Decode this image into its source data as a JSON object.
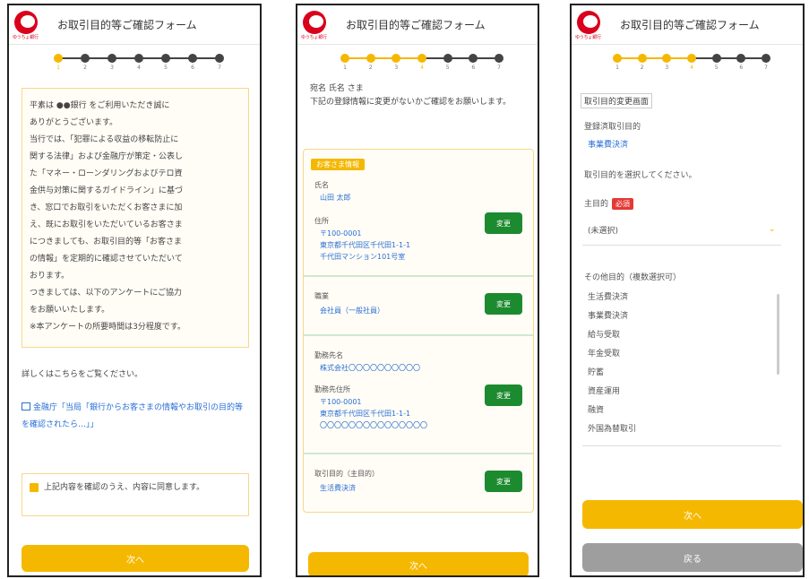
{
  "app": {
    "title": "お取引目的等ご確認フォーム",
    "logo_text": "ゆうちょ銀行"
  },
  "steps": {
    "labels": [
      "1",
      "2",
      "3",
      "4",
      "5",
      "6",
      "7"
    ]
  },
  "screen1": {
    "current_step": 1,
    "notice_lines": [
      "平素は ●●銀行 をご利用いただき誠に",
      "ありがとうございます。",
      "当行では、「犯罪による収益の移転防止に",
      "関する法律」および金融庁が策定・公表し",
      "た「マネー・ローンダリングおよびテロ資",
      "金供与対策に関するガイドライン」に基づ",
      "き、窓口でお取引をいただくお客さまに加",
      "え、既にお取引をいただいているお客さま",
      "につきましても、お取引目的等「お客さま",
      "の情報」を定期的に確認させていただいて",
      "おります。",
      "つきましては、以下のアンケートにご協力",
      "をお願いいたします。",
      "※本アンケートの所要時間は3分程度です。"
    ],
    "note": "詳しくはこちらをご覧ください。",
    "link": "金融庁「当局「銀行からお客さまの情報やお取引の目的等を確認されたら…」」",
    "consent": "上記内容を確認のうえ、内容に同意します。",
    "next_button": "次へ"
  },
  "screen2": {
    "current_step": 4,
    "intro": "宛名 氏名 さま\n下記の登録情報に変更がないかご確認をお願いします。",
    "tag": "お客さま情報",
    "block1": {
      "name_label": "氏名",
      "name_value": "山田 太郎",
      "address_label": "住所",
      "address_lines": [
        "〒100-0001",
        "東京都千代田区千代田1-1-1",
        "千代田マンション101号室"
      ],
      "change_button": "変更"
    },
    "block2": {
      "label": "職業",
      "value": "会社員（一般社員）",
      "change_button": "変更"
    },
    "block3": {
      "company_label": "勤務先名",
      "company_value": "株式会社〇〇〇〇〇〇〇〇〇〇",
      "company_addr_label": "勤務先住所",
      "company_addr_lines": [
        "〒100-0001",
        "東京都千代田区千代田1-1-1",
        "〇〇〇〇〇〇〇〇〇〇〇〇〇〇〇"
      ],
      "change_button": "変更"
    },
    "block4": {
      "label": "取引目的（主目的）",
      "value": "生活費決済",
      "change_button": "変更"
    },
    "next_button": "次へ"
  },
  "screen3": {
    "current_step": 4,
    "section": "取引目的変更画面",
    "reg_label": "登録済取引目的",
    "reg_value": "事業費決済",
    "instruction": "取引目的を選択してください。",
    "main_label": "主目的",
    "required": "必須",
    "select_placeholder": "(未選択)",
    "other_label": "その他目的（複数選択可）",
    "options": [
      "生活費決済",
      "事業費決済",
      "給与受取",
      "年金受取",
      "貯蓄",
      "資産運用",
      "融資",
      "外国為替取引"
    ],
    "next_button": "次へ",
    "back_button": "戻る"
  },
  "colors": {
    "accent": "#f5b800",
    "brand_red": "#d9001b",
    "change_green": "#1c8a2e",
    "link_blue": "#2a6fd6"
  }
}
